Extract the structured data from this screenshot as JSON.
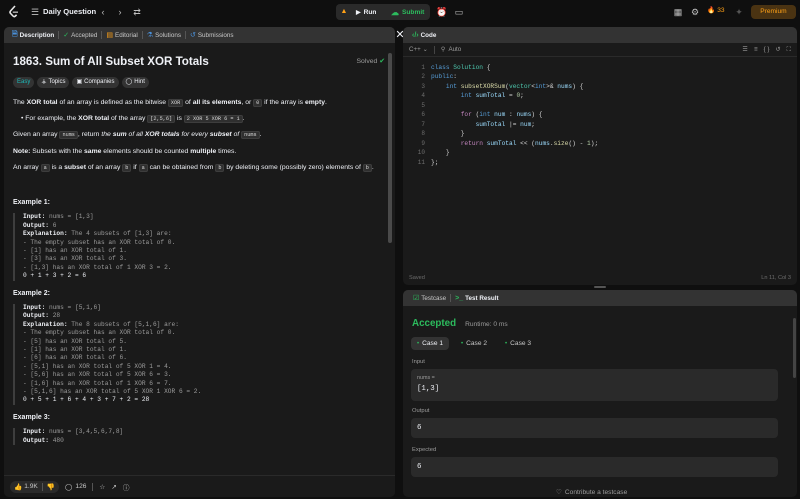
{
  "topbar": {
    "title": "Daily Question",
    "run": "Run",
    "submit": "Submit",
    "streak": "33",
    "premium": "Premium",
    "colors": {
      "accent": "#ffa116",
      "submit_green": "#2cbb5d"
    }
  },
  "left_tabs": [
    {
      "label": "Description",
      "icon": "document-icon"
    },
    {
      "label": "Accepted",
      "icon": "check-icon"
    },
    {
      "label": "Editorial",
      "icon": "book-icon"
    },
    {
      "label": "Solutions",
      "icon": "flask-icon"
    },
    {
      "label": "Submissions",
      "icon": "history-icon"
    }
  ],
  "problem": {
    "title": "1863. Sum of All Subset XOR Totals",
    "status": "Solved",
    "difficulty": "Easy",
    "chips": [
      "Topics",
      "Companies",
      "Hint"
    ],
    "p1": {
      "a": "The ",
      "b": "XOR total",
      "c": " of an array is defined as the bitwise ",
      "d": "XOR",
      "e": " of ",
      "f": "all its elements",
      "g": ", or ",
      "h": "0",
      "i": " if the array is ",
      "j": "empty",
      "k": "."
    },
    "bullet": {
      "a": "For example, the ",
      "b": "XOR total",
      "c": " of the array ",
      "d": "[2,5,6]",
      "e": " is ",
      "f": "2 XOR 5 XOR 6 = 1",
      "g": "."
    },
    "p2": {
      "a": "Given an array ",
      "b": "nums",
      "c": ", return ",
      "d": "the ",
      "e": "sum",
      "f": " of all ",
      "g": "XOR totals",
      "h": " for every ",
      "i": "subset",
      "j": " of ",
      "k": "nums",
      "l": "."
    },
    "note": {
      "a": "Note:",
      "b": " Subsets with the ",
      "c": "same",
      "d": " elements should be counted ",
      "e": "multiple",
      "f": " times."
    },
    "p3": {
      "a": "An array ",
      "b": "a",
      "c": " is a ",
      "d": "subset",
      "e": " of an array ",
      "f": "b",
      "g": " if ",
      "h": "a",
      "i": " can be obtained from ",
      "j": "b",
      "k": " by deleting some (possibly zero) elements of ",
      "l": "b",
      "m": "."
    },
    "ex1": {
      "title": "Example 1:",
      "input_l": "Input:",
      "input": " nums = [1,3]",
      "output_l": "Output:",
      "output": " 6",
      "expl_l": "Explanation:",
      "expl": " The 4 subsets of [1,3] are:",
      "lines": [
        "- The empty subset has an XOR total of 0.",
        "- [1] has an XOR total of 1.",
        "- [3] has an XOR total of 3.",
        "- [1,3] has an XOR total of 1 XOR 3 = 2.",
        "0 + 1 + 3 + 2 = 6"
      ]
    },
    "ex2": {
      "title": "Example 2:",
      "input_l": "Input:",
      "input": " nums = [5,1,6]",
      "output_l": "Output:",
      "output": " 28",
      "expl_l": "Explanation:",
      "expl": " The 8 subsets of [5,1,6] are:",
      "lines": [
        "- The empty subset has an XOR total of 0.",
        "- [5] has an XOR total of 5.",
        "- [1] has an XOR total of 1.",
        "- [6] has an XOR total of 6.",
        "- [5,1] has an XOR total of 5 XOR 1 = 4.",
        "- [5,6] has an XOR total of 5 XOR 6 = 3.",
        "- [1,6] has an XOR total of 1 XOR 6 = 7.",
        "- [5,1,6] has an XOR total of 5 XOR 1 XOR 6 = 2.",
        "0 + 5 + 1 + 6 + 4 + 3 + 7 + 2 = 28"
      ]
    },
    "ex3": {
      "title": "Example 3:",
      "input_l": "Input:",
      "input": " nums = [3,4,5,6,7,8]",
      "output_l": "Output:",
      "output": " 480"
    }
  },
  "left_footer": {
    "likes": "1.9K",
    "comments": "126"
  },
  "code": {
    "tab": "Code",
    "language": "C++",
    "mode": "Auto",
    "saved": "Saved",
    "cursor": "Ln 11, Col 3",
    "lines": [
      "1",
      "2",
      "3",
      "4",
      "5",
      "6",
      "7",
      "8",
      "9",
      "10",
      "11"
    ]
  },
  "result": {
    "tabs": [
      "Testcase",
      "Test Result"
    ],
    "status": "Accepted",
    "runtime": "Runtime: 0 ms",
    "cases": [
      "Case 1",
      "Case 2",
      "Case 3"
    ],
    "input_label": "Input",
    "var": "nums =",
    "input_value": "[1,3]",
    "output_label": "Output",
    "output_value": "6",
    "expected_label": "Expected",
    "expected_value": "6",
    "contribute": "Contribute a testcase"
  }
}
